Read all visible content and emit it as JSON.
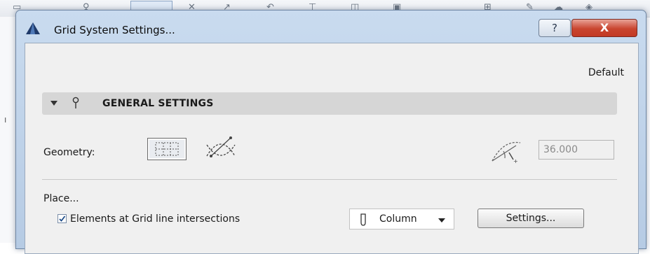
{
  "dialog": {
    "title": "Grid System Settings...",
    "help_label": "?",
    "close_label": "X",
    "preset_label": "Default"
  },
  "general_settings": {
    "header": "GENERAL SETTINGS",
    "geometry_label": "Geometry:",
    "angle_value": "36.000",
    "place_label": "Place...",
    "intersections_label": "Elements at Grid line intersections",
    "intersections_checked": true,
    "element_type": "Column",
    "settings_button": "Settings..."
  },
  "icons": {
    "app": "archicad-logo-icon",
    "section": "pin-icon",
    "geometry_rect": "rectangular-grid-icon",
    "geometry_arc": "arc-grid-icon",
    "angle": "angle-icon",
    "element": "column-icon"
  },
  "colors": {
    "titlebar": "#c9dbef",
    "close_button": "#c9452f",
    "client_bg": "#f0f0f0",
    "section_bg": "#d6d6d6"
  }
}
